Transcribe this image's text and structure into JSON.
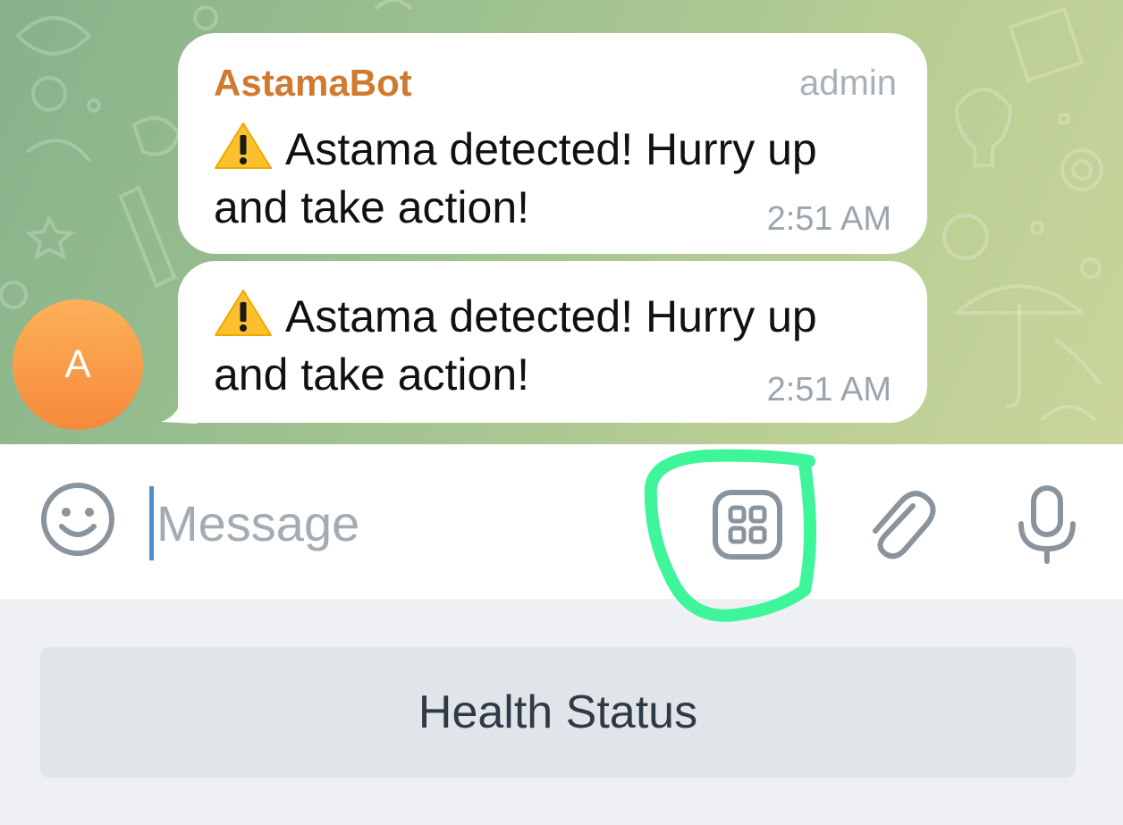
{
  "chat": {
    "messages": [
      {
        "sender": "AstamaBot",
        "role": "admin",
        "icon": "warning-icon",
        "text": "Astama detected! Hurry up and take action!",
        "time": "2:51 AM"
      },
      {
        "icon": "warning-icon",
        "text": "Astama detected! Hurry up and take action!",
        "time": "2:51 AM"
      }
    ],
    "avatar_letter": "A"
  },
  "input_bar": {
    "placeholder": "Message",
    "icons": [
      "emoji-icon",
      "bot-keyboard-icon",
      "attach-icon",
      "microphone-icon"
    ]
  },
  "keyboard": {
    "buttons": [
      {
        "label": "Health Status"
      }
    ]
  },
  "colors": {
    "sender_name": "#d07a30",
    "avatar": "#f6893a",
    "highlight": "#3ef59a",
    "cursor": "#4b8fd0"
  }
}
